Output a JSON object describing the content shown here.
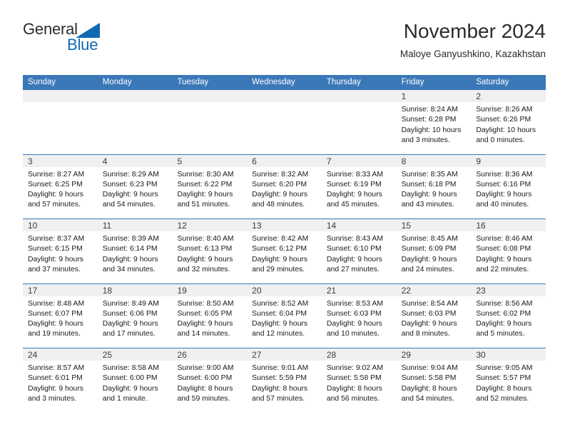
{
  "brand": {
    "name_top": "General",
    "name_bottom": "Blue",
    "accent_color": "#1268b3"
  },
  "header": {
    "title": "November 2024",
    "subtitle": "Maloye Ganyushkino, Kazakhstan"
  },
  "theme": {
    "header_blue": "#3b78b8",
    "daynum_bg": "#f0f0f0",
    "text": "#1a1a1a"
  },
  "weekdays": [
    "Sunday",
    "Monday",
    "Tuesday",
    "Wednesday",
    "Thursday",
    "Friday",
    "Saturday"
  ],
  "weeks": [
    [
      {
        "day": "",
        "lines": []
      },
      {
        "day": "",
        "lines": []
      },
      {
        "day": "",
        "lines": []
      },
      {
        "day": "",
        "lines": []
      },
      {
        "day": "",
        "lines": []
      },
      {
        "day": "1",
        "lines": [
          "Sunrise: 8:24 AM",
          "Sunset: 6:28 PM",
          "Daylight: 10 hours",
          "and 3 minutes."
        ]
      },
      {
        "day": "2",
        "lines": [
          "Sunrise: 8:26 AM",
          "Sunset: 6:26 PM",
          "Daylight: 10 hours",
          "and 0 minutes."
        ]
      }
    ],
    [
      {
        "day": "3",
        "lines": [
          "Sunrise: 8:27 AM",
          "Sunset: 6:25 PM",
          "Daylight: 9 hours",
          "and 57 minutes."
        ]
      },
      {
        "day": "4",
        "lines": [
          "Sunrise: 8:29 AM",
          "Sunset: 6:23 PM",
          "Daylight: 9 hours",
          "and 54 minutes."
        ]
      },
      {
        "day": "5",
        "lines": [
          "Sunrise: 8:30 AM",
          "Sunset: 6:22 PM",
          "Daylight: 9 hours",
          "and 51 minutes."
        ]
      },
      {
        "day": "6",
        "lines": [
          "Sunrise: 8:32 AM",
          "Sunset: 6:20 PM",
          "Daylight: 9 hours",
          "and 48 minutes."
        ]
      },
      {
        "day": "7",
        "lines": [
          "Sunrise: 8:33 AM",
          "Sunset: 6:19 PM",
          "Daylight: 9 hours",
          "and 45 minutes."
        ]
      },
      {
        "day": "8",
        "lines": [
          "Sunrise: 8:35 AM",
          "Sunset: 6:18 PM",
          "Daylight: 9 hours",
          "and 43 minutes."
        ]
      },
      {
        "day": "9",
        "lines": [
          "Sunrise: 8:36 AM",
          "Sunset: 6:16 PM",
          "Daylight: 9 hours",
          "and 40 minutes."
        ]
      }
    ],
    [
      {
        "day": "10",
        "lines": [
          "Sunrise: 8:37 AM",
          "Sunset: 6:15 PM",
          "Daylight: 9 hours",
          "and 37 minutes."
        ]
      },
      {
        "day": "11",
        "lines": [
          "Sunrise: 8:39 AM",
          "Sunset: 6:14 PM",
          "Daylight: 9 hours",
          "and 34 minutes."
        ]
      },
      {
        "day": "12",
        "lines": [
          "Sunrise: 8:40 AM",
          "Sunset: 6:13 PM",
          "Daylight: 9 hours",
          "and 32 minutes."
        ]
      },
      {
        "day": "13",
        "lines": [
          "Sunrise: 8:42 AM",
          "Sunset: 6:12 PM",
          "Daylight: 9 hours",
          "and 29 minutes."
        ]
      },
      {
        "day": "14",
        "lines": [
          "Sunrise: 8:43 AM",
          "Sunset: 6:10 PM",
          "Daylight: 9 hours",
          "and 27 minutes."
        ]
      },
      {
        "day": "15",
        "lines": [
          "Sunrise: 8:45 AM",
          "Sunset: 6:09 PM",
          "Daylight: 9 hours",
          "and 24 minutes."
        ]
      },
      {
        "day": "16",
        "lines": [
          "Sunrise: 8:46 AM",
          "Sunset: 6:08 PM",
          "Daylight: 9 hours",
          "and 22 minutes."
        ]
      }
    ],
    [
      {
        "day": "17",
        "lines": [
          "Sunrise: 8:48 AM",
          "Sunset: 6:07 PM",
          "Daylight: 9 hours",
          "and 19 minutes."
        ]
      },
      {
        "day": "18",
        "lines": [
          "Sunrise: 8:49 AM",
          "Sunset: 6:06 PM",
          "Daylight: 9 hours",
          "and 17 minutes."
        ]
      },
      {
        "day": "19",
        "lines": [
          "Sunrise: 8:50 AM",
          "Sunset: 6:05 PM",
          "Daylight: 9 hours",
          "and 14 minutes."
        ]
      },
      {
        "day": "20",
        "lines": [
          "Sunrise: 8:52 AM",
          "Sunset: 6:04 PM",
          "Daylight: 9 hours",
          "and 12 minutes."
        ]
      },
      {
        "day": "21",
        "lines": [
          "Sunrise: 8:53 AM",
          "Sunset: 6:03 PM",
          "Daylight: 9 hours",
          "and 10 minutes."
        ]
      },
      {
        "day": "22",
        "lines": [
          "Sunrise: 8:54 AM",
          "Sunset: 6:03 PM",
          "Daylight: 9 hours",
          "and 8 minutes."
        ]
      },
      {
        "day": "23",
        "lines": [
          "Sunrise: 8:56 AM",
          "Sunset: 6:02 PM",
          "Daylight: 9 hours",
          "and 5 minutes."
        ]
      }
    ],
    [
      {
        "day": "24",
        "lines": [
          "Sunrise: 8:57 AM",
          "Sunset: 6:01 PM",
          "Daylight: 9 hours",
          "and 3 minutes."
        ]
      },
      {
        "day": "25",
        "lines": [
          "Sunrise: 8:58 AM",
          "Sunset: 6:00 PM",
          "Daylight: 9 hours",
          "and 1 minute."
        ]
      },
      {
        "day": "26",
        "lines": [
          "Sunrise: 9:00 AM",
          "Sunset: 6:00 PM",
          "Daylight: 8 hours",
          "and 59 minutes."
        ]
      },
      {
        "day": "27",
        "lines": [
          "Sunrise: 9:01 AM",
          "Sunset: 5:59 PM",
          "Daylight: 8 hours",
          "and 57 minutes."
        ]
      },
      {
        "day": "28",
        "lines": [
          "Sunrise: 9:02 AM",
          "Sunset: 5:58 PM",
          "Daylight: 8 hours",
          "and 56 minutes."
        ]
      },
      {
        "day": "29",
        "lines": [
          "Sunrise: 9:04 AM",
          "Sunset: 5:58 PM",
          "Daylight: 8 hours",
          "and 54 minutes."
        ]
      },
      {
        "day": "30",
        "lines": [
          "Sunrise: 9:05 AM",
          "Sunset: 5:57 PM",
          "Daylight: 8 hours",
          "and 52 minutes."
        ]
      }
    ]
  ]
}
